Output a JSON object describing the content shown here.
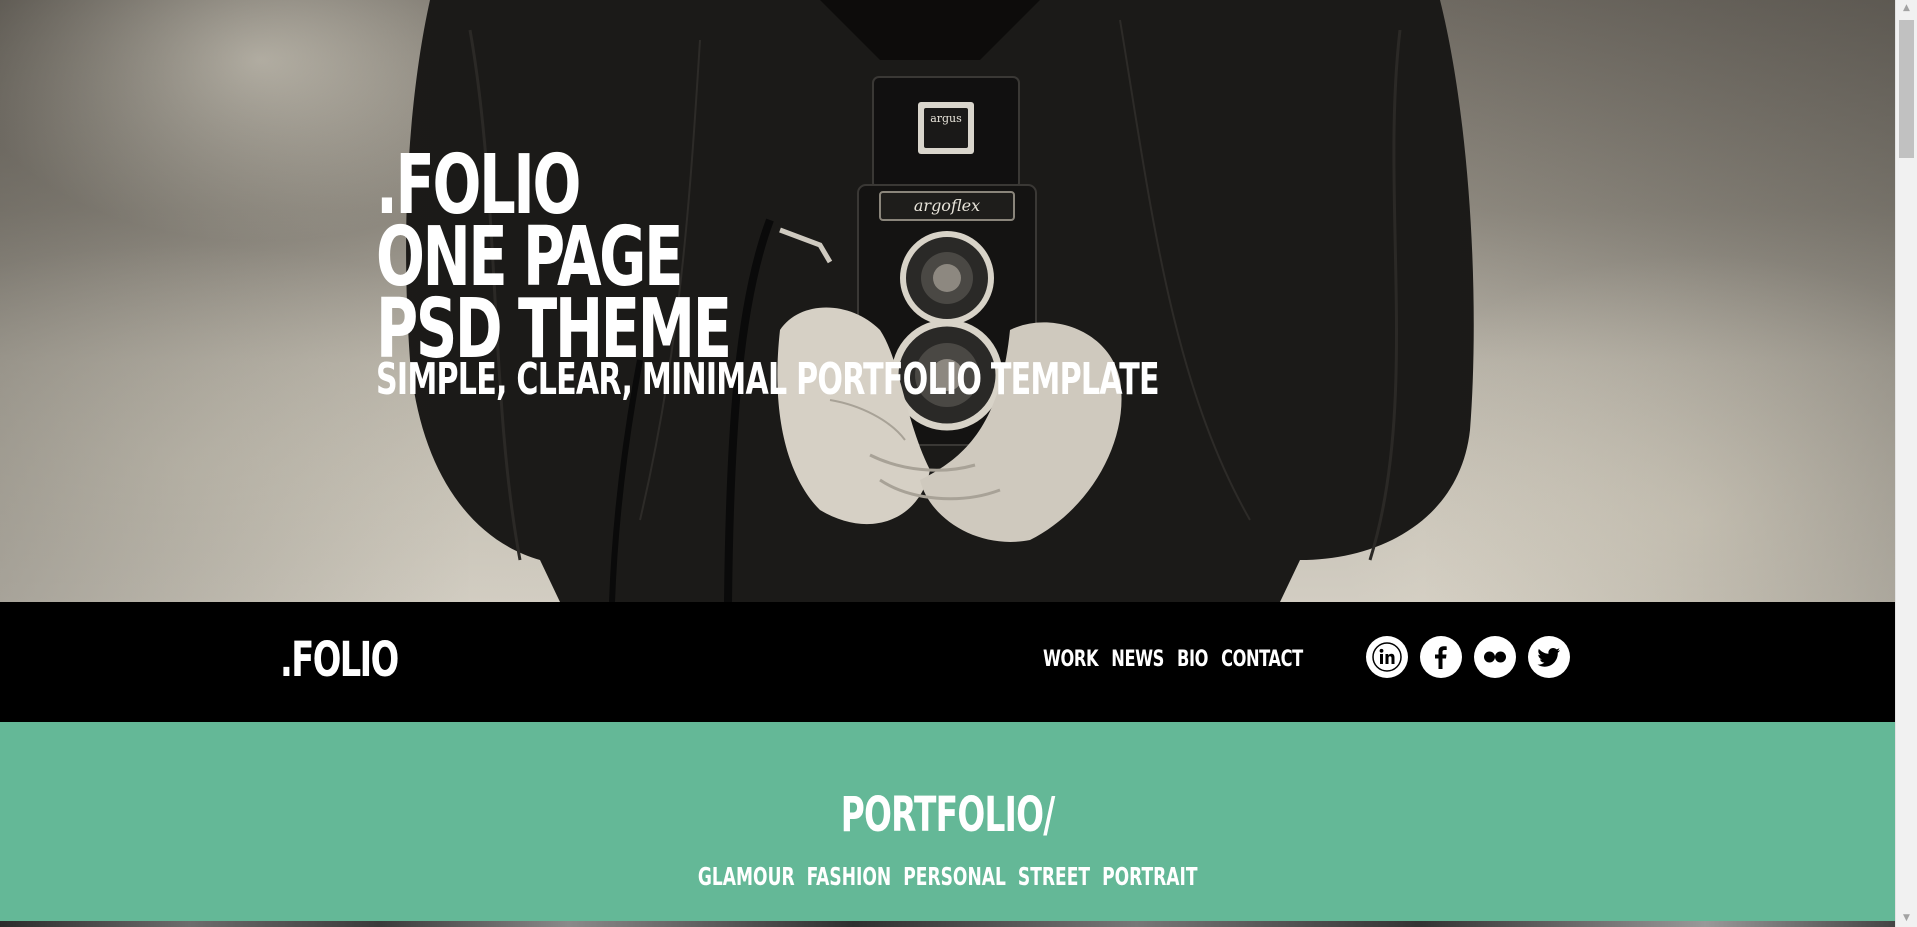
{
  "hero": {
    "lines": [
      ".FOLIO",
      "ONE PAGE",
      "PSD THEME"
    ],
    "tagline": "SIMPLE, CLEAR, MINIMAL PORTFOLIO TEMPLATE",
    "camera_labels": {
      "badge": "argus",
      "plate": "argoflex"
    }
  },
  "nav": {
    "brand": ".FOLIO",
    "links": [
      "WORK",
      "NEWS",
      "BIO",
      "CONTACT"
    ],
    "social": [
      {
        "name": "linkedin-icon",
        "glyph": "in"
      },
      {
        "name": "facebook-icon",
        "glyph": "f"
      },
      {
        "name": "flickr-icon",
        "glyph": "flickr"
      },
      {
        "name": "twitter-icon",
        "glyph": "bird"
      }
    ]
  },
  "portfolio": {
    "title": "PORTFOLIO/",
    "filters": [
      "GLAMOUR",
      "FASHION",
      "PERSONAL",
      "STREET",
      "PORTRAIT"
    ]
  },
  "colors": {
    "accent": "#64b897",
    "navbar": "#000000",
    "text": "#ffffff"
  }
}
